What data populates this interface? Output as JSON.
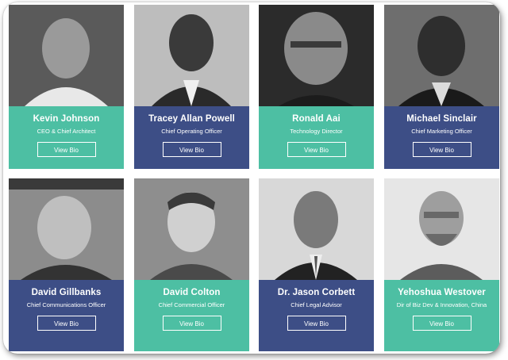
{
  "colors": {
    "teal": "#4dbfa3",
    "navy": "#3d4e86",
    "frame_bg": "#ffffff"
  },
  "team": [
    {
      "name": "Kevin Johnson",
      "role": "CEO & Chief Architect",
      "button": "View Bio",
      "color": "#4dbfa3",
      "icon": "headshot-photo"
    },
    {
      "name": "Tracey Allan Powell",
      "role": "Chief Operating Officer",
      "button": "View Bio",
      "color": "#3d4e86",
      "icon": "headshot-photo"
    },
    {
      "name": "Ronald Aai",
      "role": "Technology Director",
      "button": "View Bio",
      "color": "#4dbfa3",
      "icon": "headshot-photo"
    },
    {
      "name": "Michael Sinclair",
      "role": "Chief Marketing Officer",
      "button": "View Bio",
      "color": "#3d4e86",
      "icon": "headshot-photo"
    },
    {
      "name": "David Gillbanks",
      "role": "Chief Communications Officer",
      "button": "View Bio",
      "color": "#3d4e86",
      "icon": "headshot-photo"
    },
    {
      "name": "David Colton",
      "role": "Chief Commercial Officer",
      "button": "View Bio",
      "color": "#4dbfa3",
      "icon": "headshot-photo"
    },
    {
      "name": "Dr. Jason Corbett",
      "role": "Chief Legal Advisor",
      "button": "View Bio",
      "color": "#3d4e86",
      "icon": "headshot-photo"
    },
    {
      "name": "Yehoshua Westover",
      "role": "Dir of Biz Dev & Innovation, China",
      "button": "View Bio",
      "color": "#4dbfa3",
      "icon": "headshot-photo"
    }
  ]
}
